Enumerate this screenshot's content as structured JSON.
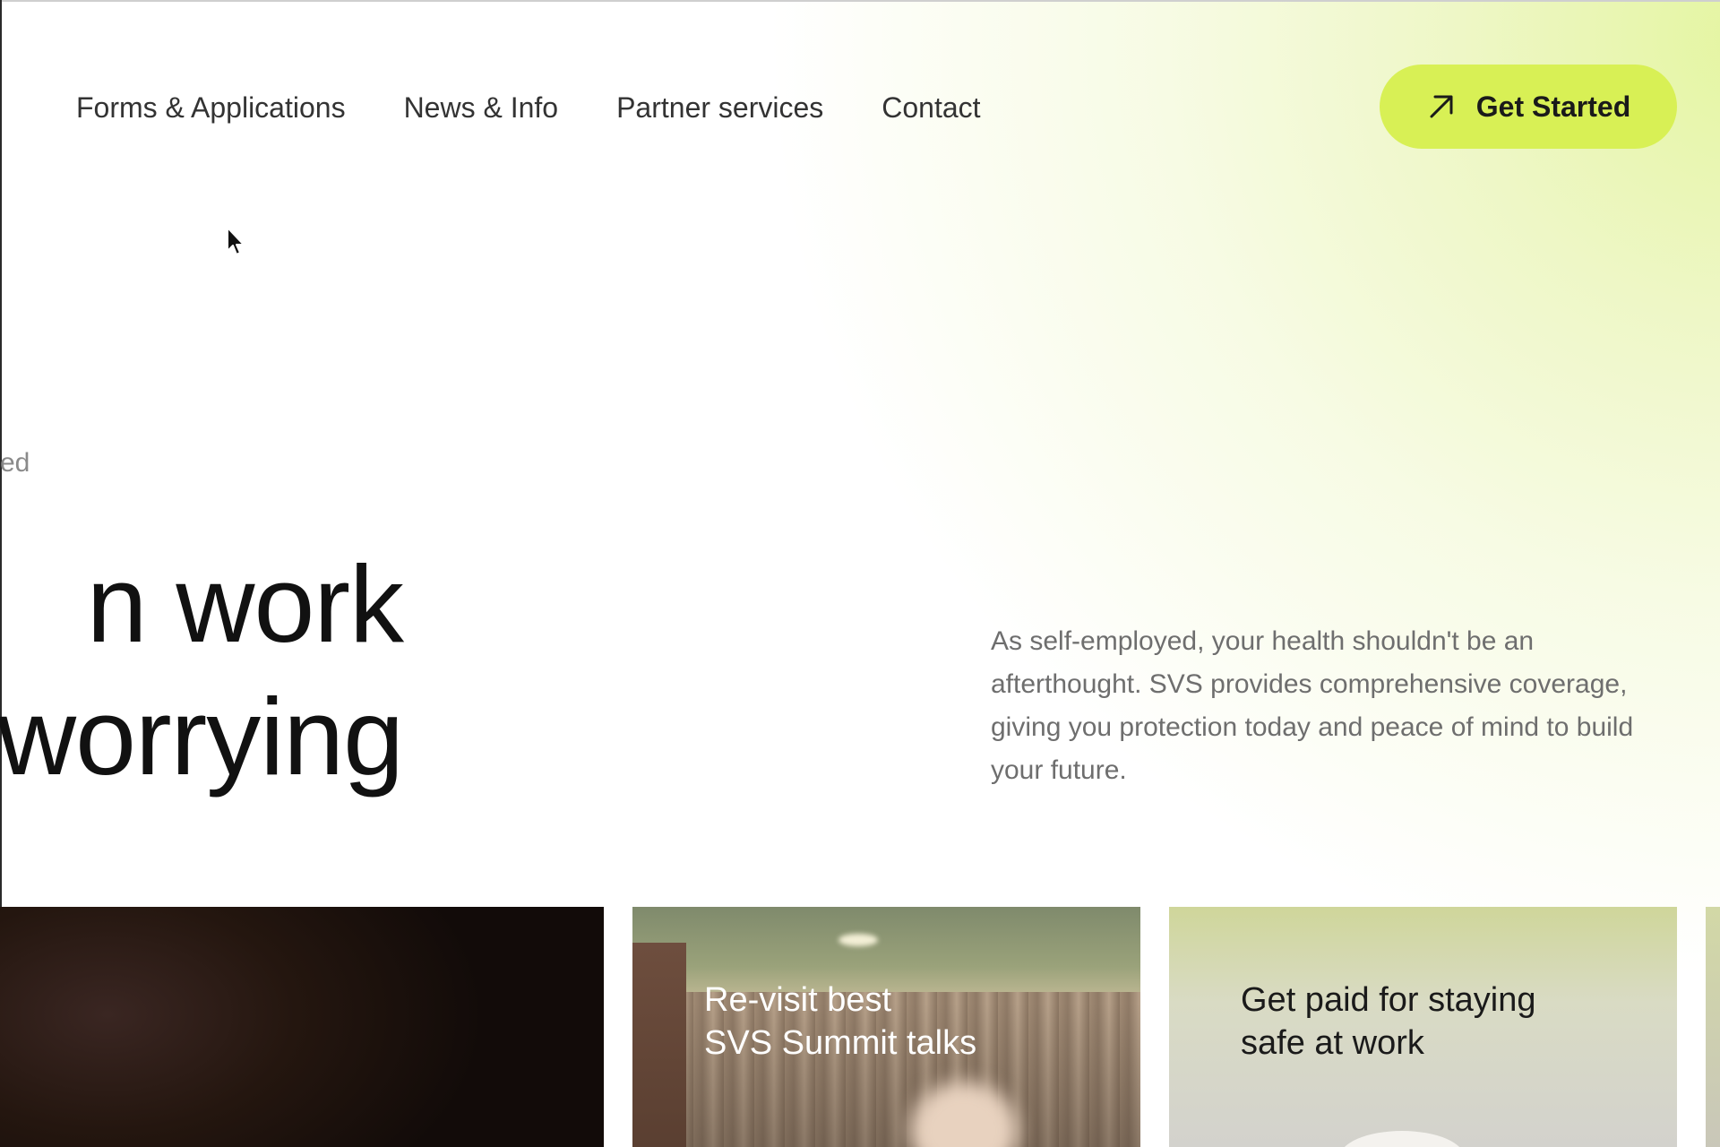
{
  "nav": {
    "items": [
      {
        "label": "Forms & Applications"
      },
      {
        "label": "News & Info"
      },
      {
        "label": "Partner services"
      },
      {
        "label": "Contact"
      }
    ],
    "cta": {
      "label": "Get Started",
      "icon": "arrow-up-right-icon"
    }
  },
  "hero": {
    "eyebrow": "ed",
    "headline_line1": "n work",
    "headline_line2": "worrying",
    "description": "As self-employed, your health shouldn't be an afterthought. SVS provides comprehensive coverage, giving you protection today and peace of mind to build your future."
  },
  "cards": [
    {
      "title": ""
    },
    {
      "title": "Re-visit best\nSVS Summit talks"
    },
    {
      "title": "Get paid for staying\nsafe at work"
    }
  ],
  "colors": {
    "accent": "#d8f055",
    "text": "#1a1a1a",
    "muted": "#6e6e6e"
  }
}
